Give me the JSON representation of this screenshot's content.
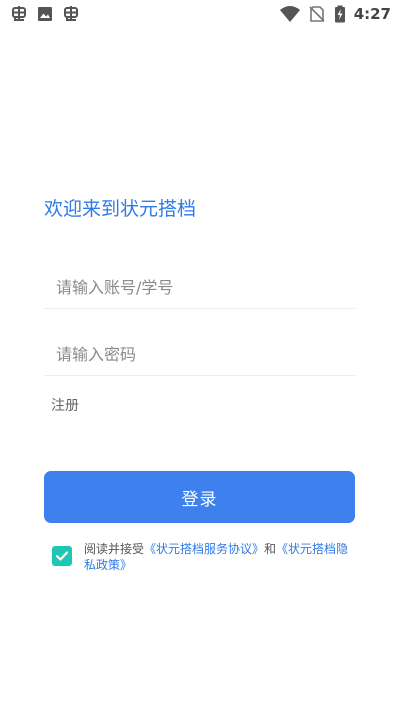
{
  "status_bar": {
    "left_icons": [
      "bug-icon",
      "image-icon",
      "bug-icon"
    ],
    "right_icons": [
      "wifi-icon",
      "no-sim-icon",
      "battery-charging-icon"
    ],
    "time": "4:27"
  },
  "login": {
    "welcome": "欢迎来到状元搭档",
    "account_placeholder": "请输入账号/学号",
    "password_placeholder": "请输入密码",
    "register": "注册",
    "login_button": "登录"
  },
  "agreement": {
    "checked": true,
    "prefix": "阅读并接受",
    "service_link": "《状元搭档服务协议》",
    "conjunction": "和",
    "privacy_link": "《状元搭档隐私政策》"
  },
  "colors": {
    "accent": "#2f7ae8",
    "button": "#3d80ee",
    "checkbox": "#1ec7b4"
  }
}
